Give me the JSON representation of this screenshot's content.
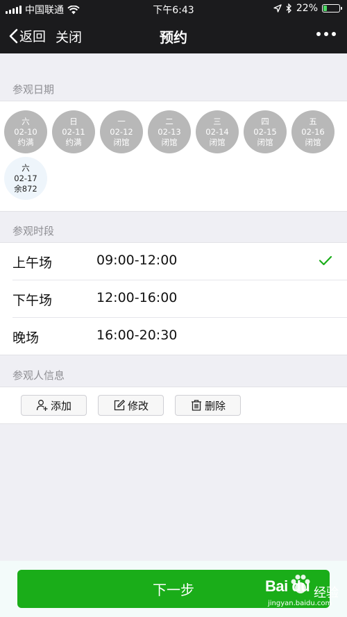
{
  "status_bar": {
    "carrier": "中国联通",
    "time": "下午6:43",
    "battery": "22%",
    "battery_level": 0.22,
    "battery_color": "#4cd964"
  },
  "nav": {
    "back_label": "返回",
    "close_label": "关闭",
    "title": "预约",
    "more_icon": "more-icon"
  },
  "dates_section": {
    "label": "参观日期",
    "dates": [
      {
        "weekday": "六",
        "date": "02-10",
        "status": "约满",
        "available": false
      },
      {
        "weekday": "日",
        "date": "02-11",
        "status": "约满",
        "available": false
      },
      {
        "weekday": "一",
        "date": "02-12",
        "status": "闭馆",
        "available": false
      },
      {
        "weekday": "二",
        "date": "02-13",
        "status": "闭馆",
        "available": false
      },
      {
        "weekday": "三",
        "date": "02-14",
        "status": "闭馆",
        "available": false
      },
      {
        "weekday": "四",
        "date": "02-15",
        "status": "闭馆",
        "available": false
      },
      {
        "weekday": "五",
        "date": "02-16",
        "status": "闭馆",
        "available": false
      },
      {
        "weekday": "六",
        "date": "02-17",
        "status": "余872",
        "available": true
      }
    ]
  },
  "sessions_section": {
    "label": "参观时段",
    "sessions": [
      {
        "name": "上午场",
        "time": "09:00-12:00",
        "selected": true
      },
      {
        "name": "下午场",
        "time": "12:00-16:00",
        "selected": false
      },
      {
        "name": "晚场",
        "time": "16:00-20:30",
        "selected": false
      }
    ]
  },
  "visitors_section": {
    "label": "参观人信息",
    "add_label": "添加",
    "edit_label": "修改",
    "delete_label": "删除"
  },
  "footer": {
    "next_label": "下一步",
    "accent_color": "#1aad19"
  },
  "watermark": {
    "logo": "Bai du",
    "text": "经验",
    "url": "jingyan.baidu.com"
  }
}
